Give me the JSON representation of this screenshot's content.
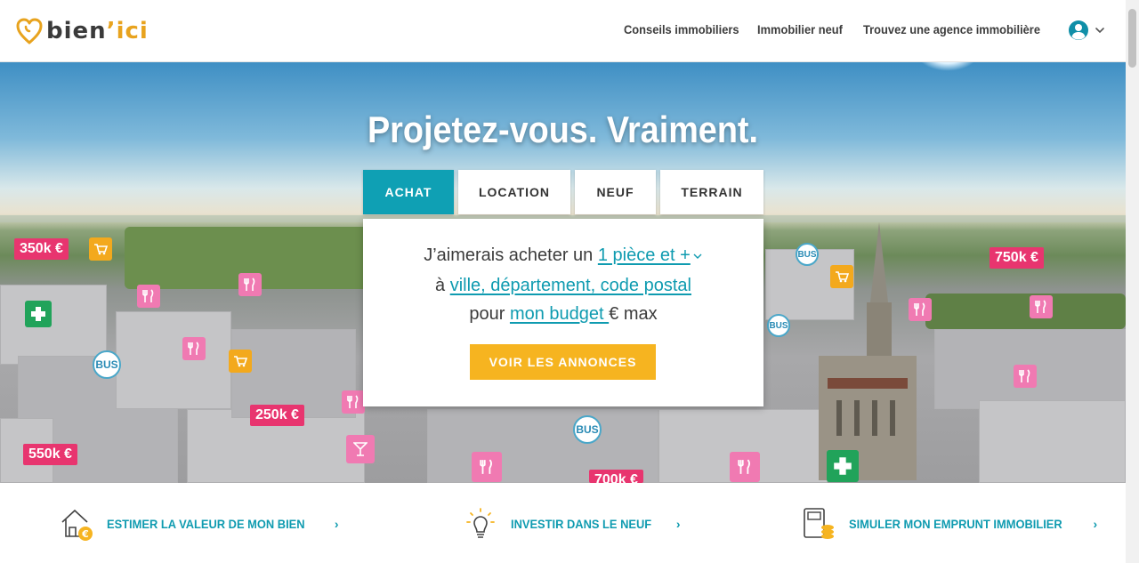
{
  "brand": {
    "name_main": "bien",
    "apostrophe": "’",
    "name_accent": "ici",
    "accent_color": "#e8a31e",
    "primary_color": "#0fa0b4"
  },
  "nav": {
    "links": [
      "Conseils immobiliers",
      "Immobilier neuf",
      "Trouvez une agence immobilière"
    ],
    "user_icon": "user-circle-icon"
  },
  "hero": {
    "title": "Projetez-vous. Vraiment.",
    "tabs": [
      "ACHAT",
      "LOCATION",
      "NEUF",
      "TERRAIN"
    ],
    "active_tab": "ACHAT",
    "search": {
      "line1_prefix": "J’aimerais acheter un ",
      "rooms_value": "1 pièce et +",
      "line2_prefix": "à ",
      "location_placeholder": "ville, département, code postal",
      "line3_prefix": "pour ",
      "budget_placeholder": "mon budget ",
      "line3_suffix": "€ max",
      "cta": "VOIR LES ANNONCES"
    },
    "map_labels": {
      "prices": [
        "350k €",
        "750k €",
        "250k €",
        "550k €",
        "700k €"
      ],
      "bus": "BUS"
    }
  },
  "features": [
    {
      "label": "ESTIMER LA VALEUR DE MON BIEN",
      "icon": "house-euro-icon"
    },
    {
      "label": "INVESTIR DANS LE NEUF",
      "icon": "lightbulb-icon"
    },
    {
      "label": "SIMULER MON EMPRUNT IMMOBILIER",
      "icon": "calculator-coins-icon"
    }
  ]
}
